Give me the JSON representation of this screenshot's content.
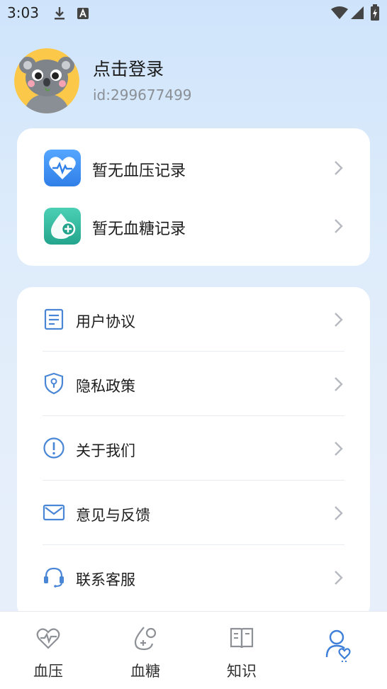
{
  "status_bar": {
    "time": "3:03",
    "icons": [
      "download-icon",
      "a-icon",
      "wifi-icon",
      "signal-icon",
      "battery-icon"
    ]
  },
  "profile": {
    "login_text": "点击登录",
    "user_id": "id:299677499"
  },
  "records": [
    {
      "label": "暂无血压记录",
      "icon": "heart-pulse-icon",
      "color": "#3a8ef0"
    },
    {
      "label": "暂无血糖记录",
      "icon": "blood-drop-icon",
      "color": "#2bb39a"
    }
  ],
  "menu": [
    {
      "label": "用户协议",
      "icon": "document-icon"
    },
    {
      "label": "隐私政策",
      "icon": "shield-icon"
    },
    {
      "label": "关于我们",
      "icon": "info-icon"
    },
    {
      "label": "意见与反馈",
      "icon": "mail-icon"
    },
    {
      "label": "联系客服",
      "icon": "headset-icon"
    }
  ],
  "tabs": [
    {
      "label": "血压",
      "icon": "blood-pressure-icon",
      "active": false
    },
    {
      "label": "血糖",
      "icon": "blood-sugar-icon",
      "active": false
    },
    {
      "label": "知识",
      "icon": "book-icon",
      "active": false
    },
    {
      "label": "",
      "icon": "profile-icon",
      "active": true
    }
  ],
  "colors": {
    "icon_blue": "#4a86d6",
    "chevron": "#b6bac0",
    "avatar_bg": "#fbc84a"
  }
}
